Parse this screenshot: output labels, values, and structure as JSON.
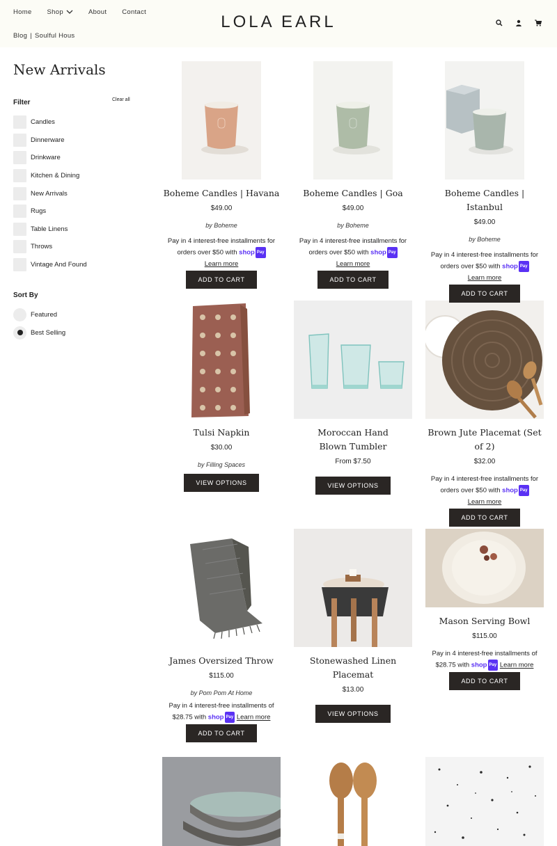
{
  "header": {
    "nav": [
      {
        "label": "Home"
      },
      {
        "label": "Shop"
      },
      {
        "label": "About"
      },
      {
        "label": "Contact"
      }
    ],
    "breadcrumb": [
      "Blog",
      "Soulful Hous"
    ],
    "logo": "LOLA EARL",
    "icons": [
      "search-icon",
      "account-icon",
      "cart-icon"
    ]
  },
  "sidebar": {
    "title": "New Arrivals",
    "filter_label": "Filter",
    "clear_all": "Clear all",
    "filters": [
      "Candles",
      "Dinnerware",
      "Drinkware",
      "Kitchen & Dining",
      "New Arrivals",
      "Rugs",
      "Table Linens",
      "Throws",
      "Vintage And Found"
    ],
    "sort_label": "Sort By",
    "sort_options": [
      {
        "label": "Featured",
        "selected": false
      },
      {
        "label": "Best Selling",
        "selected": true
      }
    ]
  },
  "shop_pay": {
    "line1": "Pay in 4 interest-free installments for",
    "line2_prefix": "orders over $50 with",
    "brand": "shop",
    "badge": "Pay",
    "learn_more": "Learn more",
    "alt_line1": "Pay in 4 interest-free installments of",
    "alt_115": "$28.75 with"
  },
  "products": [
    {
      "name": "Boheme Candles | Havana",
      "price": "$49.00",
      "vendor": "by Boheme",
      "button": "ADD TO CART"
    },
    {
      "name": "Boheme Candles | Goa",
      "price": "$49.00",
      "vendor": "by Boheme",
      "button": "ADD TO CART"
    },
    {
      "name": "Boheme Candles | Istanbul",
      "price": "$49.00",
      "vendor": "by Boheme",
      "button": "ADD TO CART"
    },
    {
      "name": "Tulsi Napkin",
      "price": "$30.00",
      "vendor": "by Filling Spaces",
      "button": "VIEW OPTIONS"
    },
    {
      "name": "Moroccan Hand Blown Tumbler",
      "price": "From $7.50",
      "button": "VIEW OPTIONS"
    },
    {
      "name": "Brown Jute Placemat (Set of 2)",
      "price": "$32.00",
      "button": "ADD TO CART"
    },
    {
      "name": "James Oversized Throw",
      "price": "$115.00",
      "vendor": "by Pom Pom At Home",
      "button": "ADD TO CART"
    },
    {
      "name": "Stonewashed Linen Placemat",
      "price": "$13.00",
      "button": "VIEW OPTIONS"
    },
    {
      "name": "Mason Serving Bowl",
      "price": "$115.00",
      "button": "ADD TO CART"
    }
  ],
  "colors": {
    "header_bg": "#fcfcf6",
    "button_bg": "#2a2624",
    "shop_pay": "#5a31f4"
  }
}
